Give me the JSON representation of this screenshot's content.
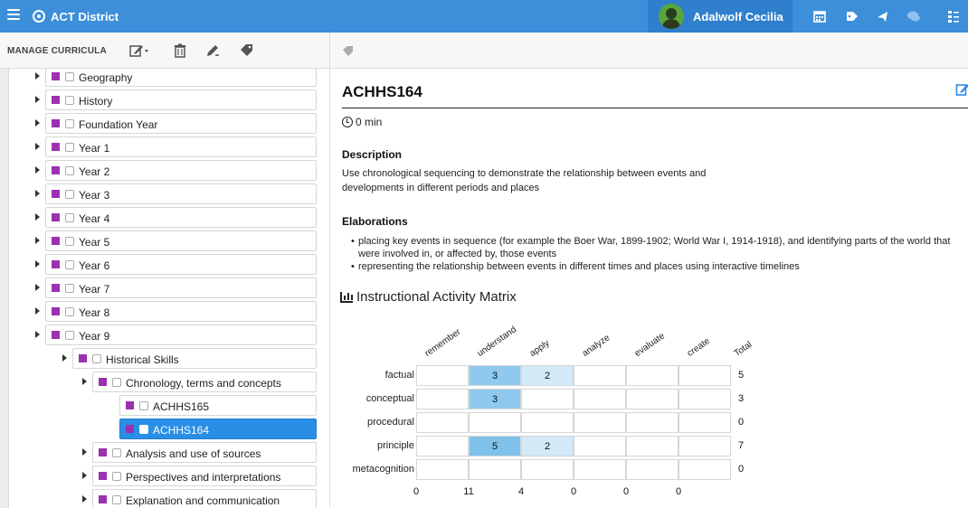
{
  "topbar": {
    "district": "ACT District",
    "user_name": "Adalwolf Cecilia",
    "icons": [
      "menu-icon",
      "district-icon",
      "calendar-icon",
      "tag-icon",
      "announce-icon",
      "chat-icon",
      "list-icon"
    ],
    "colors": {
      "bar": "#3d8fd9",
      "user_block": "#2f7fcc"
    }
  },
  "subbar": {
    "manage_label": "MANAGE CURRICULA",
    "icons": [
      "edit-dropdown-icon",
      "trash-icon",
      "pencil-icon",
      "tag-icon"
    ]
  },
  "tree": {
    "nodes": [
      {
        "label": "Geography",
        "level": 0,
        "expandable": true,
        "selected": false
      },
      {
        "label": "History",
        "level": 0,
        "expandable": true,
        "selected": false
      },
      {
        "label": "Foundation Year",
        "level": 1,
        "expandable": true,
        "selected": false
      },
      {
        "label": "Year 1",
        "level": 1,
        "expandable": true,
        "selected": false
      },
      {
        "label": "Year 2",
        "level": 1,
        "expandable": true,
        "selected": false
      },
      {
        "label": "Year 3",
        "level": 1,
        "expandable": true,
        "selected": false
      },
      {
        "label": "Year 4",
        "level": 1,
        "expandable": true,
        "selected": false
      },
      {
        "label": "Year 5",
        "level": 1,
        "expandable": true,
        "selected": false
      },
      {
        "label": "Year 6",
        "level": 1,
        "expandable": true,
        "selected": false
      },
      {
        "label": "Year 7",
        "level": 1,
        "expandable": true,
        "selected": false
      },
      {
        "label": "Year 8",
        "level": 1,
        "expandable": true,
        "selected": false
      },
      {
        "label": "Year 9",
        "level": 1,
        "expandable": true,
        "selected": false
      },
      {
        "label": "Historical Skills",
        "level": 2,
        "expandable": true,
        "selected": false
      },
      {
        "label": "Chronology, terms and concepts",
        "level": 3,
        "expandable": true,
        "selected": false
      },
      {
        "label": "ACHHS165",
        "level": 4,
        "expandable": false,
        "selected": false
      },
      {
        "label": "ACHHS164",
        "level": 4,
        "expandable": false,
        "selected": true
      },
      {
        "label": "Analysis and use of sources",
        "level": 3,
        "expandable": true,
        "selected": false
      },
      {
        "label": "Perspectives and interpretations",
        "level": 3,
        "expandable": true,
        "selected": false
      },
      {
        "label": "Explanation and communication",
        "level": 3,
        "expandable": true,
        "selected": false
      }
    ],
    "colors": {
      "marker": "#9b30b0",
      "selected": "#2a8ee6"
    }
  },
  "detail": {
    "code": "ACHHS164",
    "duration": "0 min",
    "description_title": "Description",
    "description_line1": "Use chronological sequencing to demonstrate the relationship between events and",
    "description_line2": "developments in different periods and places",
    "elaborations_title": "Elaborations",
    "elaborations": [
      "placing key events in sequence (for example the Boer War, 1899-1902; World War I, 1914-1918), and identifying parts of the world that were involved in, or affected by, those events",
      "representing the relationship between events in different times and places using interactive timelines"
    ]
  },
  "matrix": {
    "title": "Instructional Activity Matrix",
    "columns": [
      "remember",
      "understand",
      "apply",
      "analyze",
      "evaluate",
      "create"
    ],
    "total_label": "Total",
    "rows": [
      {
        "label": "factual",
        "cells": [
          "",
          "3",
          "2",
          "",
          "",
          ""
        ],
        "total": "5"
      },
      {
        "label": "conceptual",
        "cells": [
          "",
          "3",
          "",
          "",
          "",
          ""
        ],
        "total": "3"
      },
      {
        "label": "procedural",
        "cells": [
          "",
          "",
          "",
          "",
          "",
          ""
        ],
        "total": "0"
      },
      {
        "label": "principle",
        "cells": [
          "",
          "5",
          "2",
          "",
          "",
          ""
        ],
        "total": "7"
      },
      {
        "label": "metacognition",
        "cells": [
          "",
          "",
          "",
          "",
          "",
          ""
        ],
        "total": "0"
      }
    ],
    "column_totals": [
      "0",
      "11",
      "4",
      "0",
      "0",
      "0"
    ],
    "colors": {
      "high": "#7fc1ea",
      "mid": "#8fc9ee",
      "low": "#d2e9f8"
    }
  }
}
